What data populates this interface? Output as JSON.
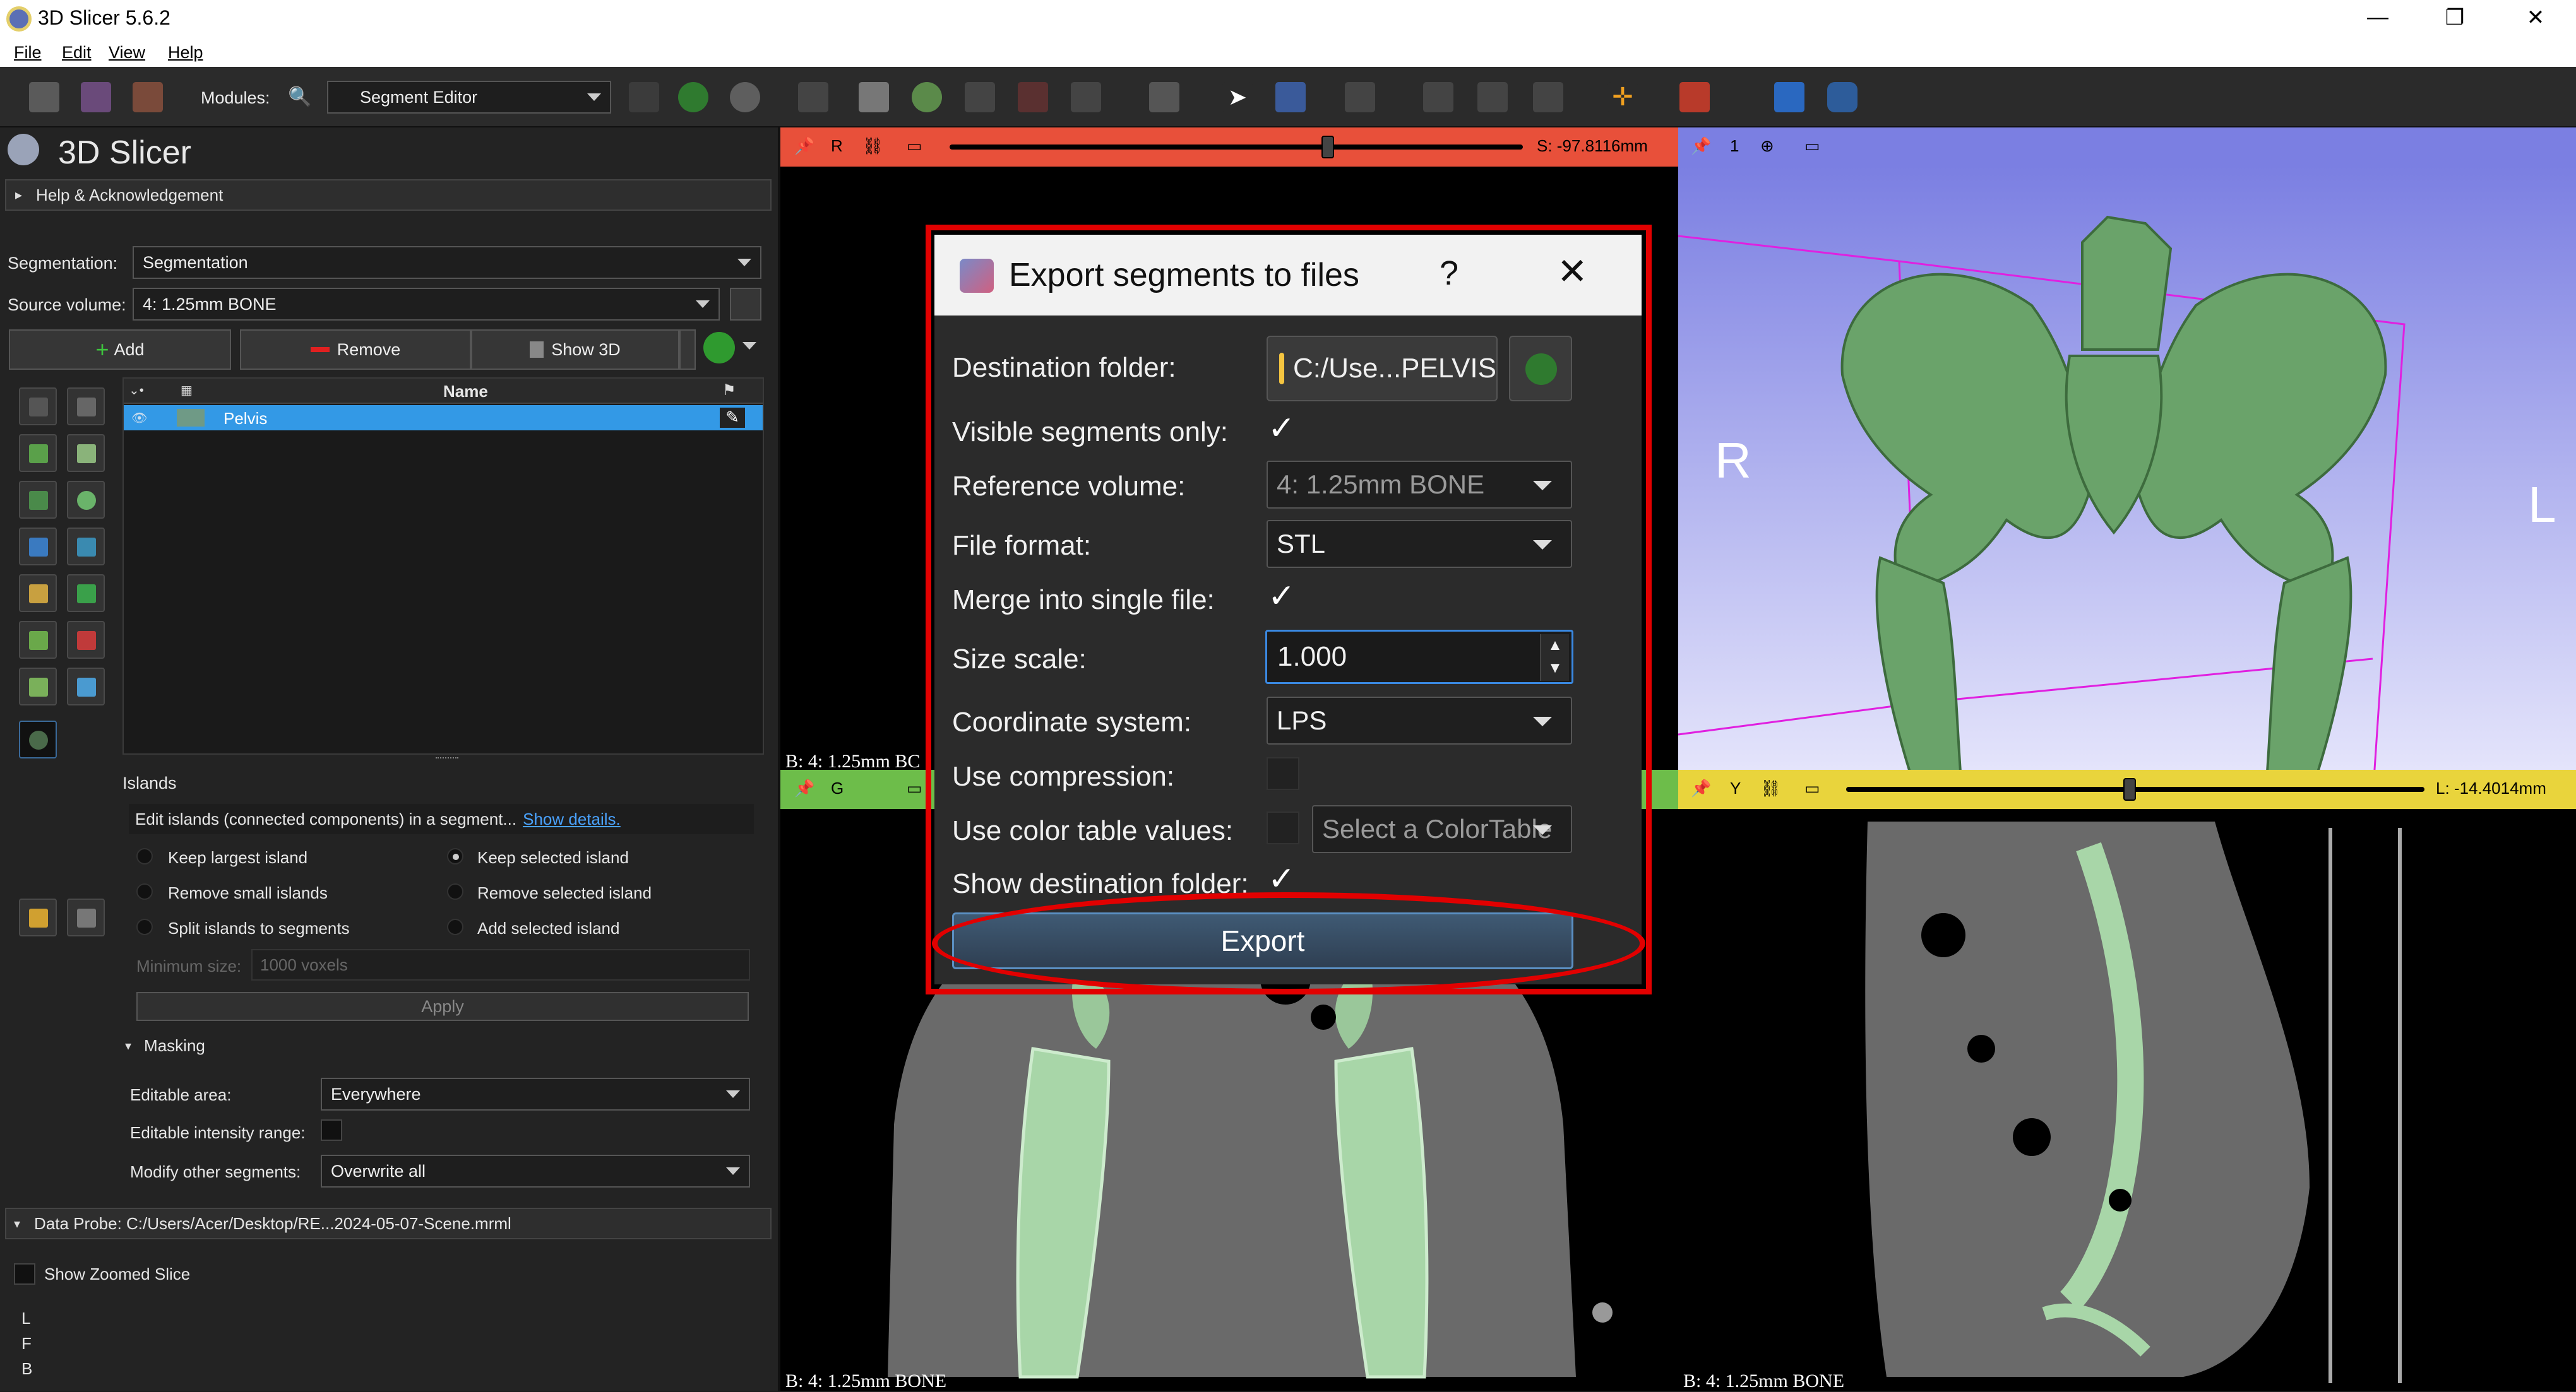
{
  "app": {
    "title": "3D Slicer 5.6.2"
  },
  "window_controls": {
    "minimize": "—",
    "maximize": "❐",
    "close": "✕"
  },
  "menu": [
    "File",
    "Edit",
    "View",
    "Help"
  ],
  "toolbar": {
    "modules_label": "Modules:",
    "module_selected": "Segment Editor"
  },
  "left_panel": {
    "brand": "3D Slicer",
    "help_section": "Help & Acknowledgement",
    "segmentation_label": "Segmentation:",
    "segmentation_value": "Segmentation",
    "source_volume_label": "Source volume:",
    "source_volume_value": "4: 1.25mm BONE",
    "add_button": "Add",
    "remove_button": "Remove",
    "show3d_button": "Show 3D",
    "table_header_name": "Name",
    "segments": [
      {
        "name": "Pelvis",
        "color": "#6f9a86"
      }
    ],
    "effect_title": "Islands",
    "effect_description": "Edit islands (connected components) in a segment...",
    "show_details_link": "Show details.",
    "radio_options": [
      {
        "label": "Keep largest island",
        "selected": false
      },
      {
        "label": "Keep selected island",
        "selected": true
      },
      {
        "label": "Remove small islands",
        "selected": false
      },
      {
        "label": "Remove selected island",
        "selected": false
      },
      {
        "label": "Split islands to segments",
        "selected": false
      },
      {
        "label": "Add selected island",
        "selected": false
      }
    ],
    "min_size_label": "Minimum size:",
    "min_size_value": "1000 voxels",
    "apply_button": "Apply",
    "masking_section": "Masking",
    "editable_area_label": "Editable area:",
    "editable_area_value": "Everywhere",
    "editable_intensity_label": "Editable intensity range:",
    "modify_other_label": "Modify other segments:",
    "modify_other_value": "Overwrite all",
    "data_probe": "Data Probe: C:/Users/Acer/Desktop/RE...2024-05-07-Scene.mrml",
    "show_zoomed_slice": "Show Zoomed Slice",
    "probe_lines": [
      "L",
      "F",
      "B"
    ]
  },
  "views": {
    "red": {
      "letter": "R",
      "offset": "S: -97.8116mm",
      "color": "#e8503a",
      "label": "B: 4: 1.25mm BC"
    },
    "threed": {
      "number": "1",
      "color": "#7b7fe2",
      "left_marker": "R",
      "right_marker": "L"
    },
    "green": {
      "letter": "G",
      "color": "#6dbd4a",
      "label": "B: 4: 1.25mm BONE"
    },
    "yellow": {
      "letter": "Y",
      "offset": "L: -14.4014mm",
      "color": "#e9d43c",
      "label": "B: 4: 1.25mm BONE"
    },
    "red_slider_fraction": 0.66,
    "yellow_slider_fraction": 0.49
  },
  "dialog": {
    "title": "Export segments to files",
    "help": "?",
    "close": "✕",
    "destination_label": "Destination folder:",
    "destination_value": "C:/Use...PELVIS",
    "visible_only_label": "Visible segments only:",
    "visible_only_checked": true,
    "reference_volume_label": "Reference volume:",
    "reference_volume_value": "4: 1.25mm BONE",
    "file_format_label": "File format:",
    "file_format_value": "STL",
    "merge_label": "Merge into single file:",
    "merge_checked": true,
    "size_scale_label": "Size scale:",
    "size_scale_value": "1.000",
    "coordinate_label": "Coordinate system:",
    "coordinate_value": "LPS",
    "compression_label": "Use compression:",
    "compression_checked": false,
    "color_table_label": "Use color table values:",
    "color_table_checked": false,
    "color_table_placeholder": "Select a ColorTable",
    "show_folder_label": "Show destination folder:",
    "show_folder_checked": true,
    "export_button": "Export"
  },
  "annotation_color": "#e20000"
}
